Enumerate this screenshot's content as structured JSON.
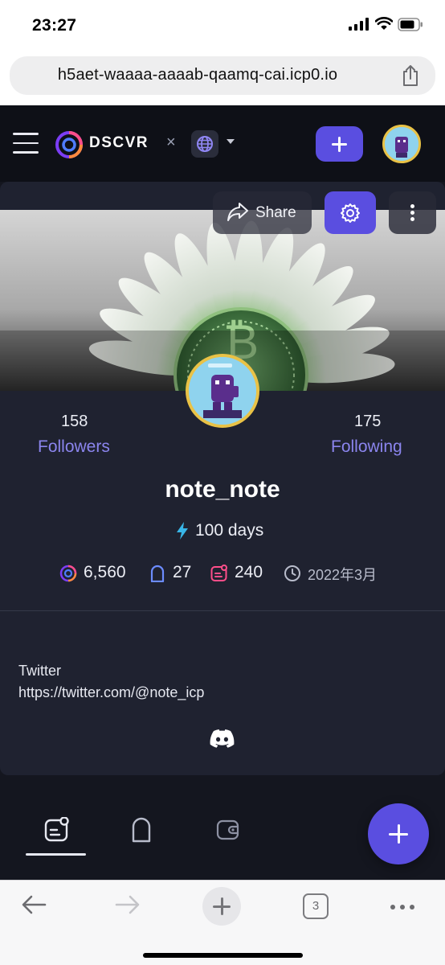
{
  "status_bar": {
    "time": "23:27"
  },
  "browser": {
    "url": "h5aet-waaaa-aaaab-qaamq-cai.icp0.io",
    "tab_count": "3"
  },
  "app": {
    "brand": "DSCVR",
    "separator": "×",
    "share_label": "Share"
  },
  "profile": {
    "followers_count": "158",
    "followers_label": "Followers",
    "following_count": "175",
    "following_label": "Following",
    "username": "note_note",
    "streak": "100 days",
    "points": "6,560",
    "portals": "27",
    "posts": "240",
    "joined": "2022年3月",
    "bio_title": "Twitter",
    "bio_link": "https://twitter.com/@note_icp"
  },
  "colors": {
    "accent": "#5a4ee0",
    "link": "#8b85ee",
    "card_bg": "#1f2230",
    "app_bg": "#14161f",
    "avatar_ring": "#e9c246"
  }
}
